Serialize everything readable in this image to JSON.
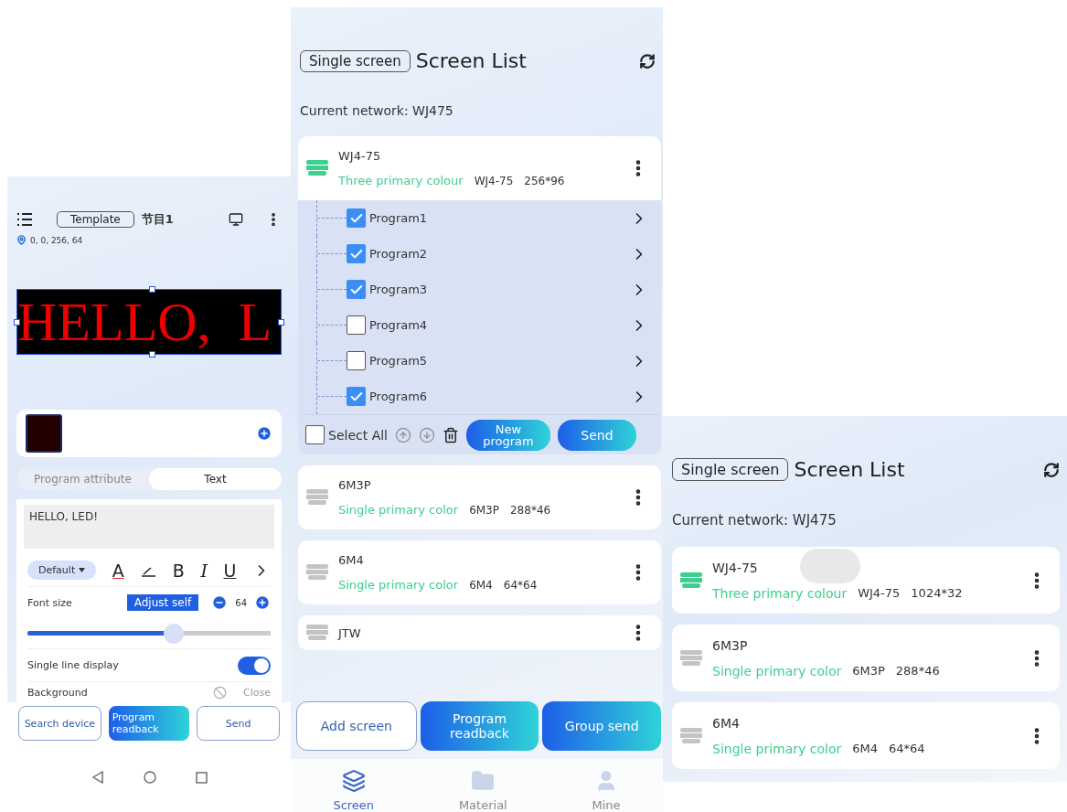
{
  "editor": {
    "template_button": "Template",
    "title": "节目1",
    "coordinates": "0, 0, 256, 64",
    "preview_text": "HELLO,  L",
    "tabs": [
      {
        "label": "Program attribute",
        "selected": false
      },
      {
        "label": "Text",
        "selected": true
      }
    ],
    "text_value": "HELLO, LED!",
    "font_dropdown": "Default",
    "format_tools": [
      {
        "kind": "color",
        "label": "A"
      },
      {
        "kind": "pen"
      },
      {
        "kind": "bold",
        "label": "B"
      },
      {
        "kind": "italic",
        "label": "I"
      },
      {
        "kind": "underline",
        "label": "U"
      },
      {
        "kind": "more"
      }
    ],
    "font_size": {
      "label": "Font size",
      "adjust_button": "Adjust self",
      "value": "64",
      "level": 0.6
    },
    "single_line": {
      "label": "Single line display",
      "on": true
    },
    "background": {
      "label": "Background",
      "value": "Close"
    },
    "buttons": [
      {
        "label": "Search device",
        "kind": "outline"
      },
      {
        "label": "Program readback",
        "kind": "gradient"
      },
      {
        "label": "Send",
        "kind": "outline"
      }
    ]
  },
  "screen_list": {
    "mode_button": "Single screen",
    "title": "Screen List",
    "network": "Current network: WJ475",
    "screens": [
      {
        "name": "WJ4-75",
        "type_label": "Three primary colour",
        "model": "WJ4-75",
        "resolution": "256*96",
        "color": "#3ecf8e",
        "expanded": true,
        "programs": [
          {
            "name": "Program1",
            "checked": true
          },
          {
            "name": "Program2",
            "checked": true
          },
          {
            "name": "Program3",
            "checked": true
          },
          {
            "name": "Program4",
            "checked": false
          },
          {
            "name": "Program5",
            "checked": false
          },
          {
            "name": "Program6",
            "checked": true
          }
        ]
      },
      {
        "name": "6M3P",
        "type_label": "Single primary color",
        "model": "6M3P",
        "resolution": "288*46",
        "color": "#c4c4c4",
        "expanded": false
      },
      {
        "name": "6M4",
        "type_label": "Single primary color",
        "model": "6M4",
        "resolution": "64*64",
        "color": "#c4c4c4",
        "expanded": false
      },
      {
        "name": "JTW",
        "color": "#c4c4c4",
        "expanded": false
      }
    ],
    "program_toolbar": {
      "select_all": {
        "label": "Select All",
        "checked": false
      },
      "new_program": "New program",
      "send": "Send"
    },
    "buttons": [
      {
        "label": "Add screen",
        "kind": "outline"
      },
      {
        "label": "Program readback",
        "kind": "gradient"
      },
      {
        "label": "Group send",
        "kind": "gradient"
      }
    ],
    "nav": [
      {
        "label": "Screen",
        "selected": true
      },
      {
        "label": "Material",
        "selected": false
      },
      {
        "label": "Mine",
        "selected": false
      }
    ]
  },
  "screen_list_2": {
    "mode_button": "Single screen",
    "title": "Screen List",
    "network": "Current network: WJ475",
    "screens": [
      {
        "name": "WJ4-75",
        "type_label": "Three primary colour",
        "model": "WJ4-75",
        "resolution": "1024*32",
        "color": "#3ecf8e",
        "expanded": false
      },
      {
        "name": "6M3P",
        "type_label": "Single primary color",
        "model": "6M3P",
        "resolution": "288*46",
        "color": "#c4c4c4",
        "expanded": false
      },
      {
        "name": "6M4",
        "type_label": "Single primary color",
        "model": "6M4",
        "resolution": "64*64",
        "color": "#c4c4c4",
        "expanded": false
      }
    ]
  }
}
